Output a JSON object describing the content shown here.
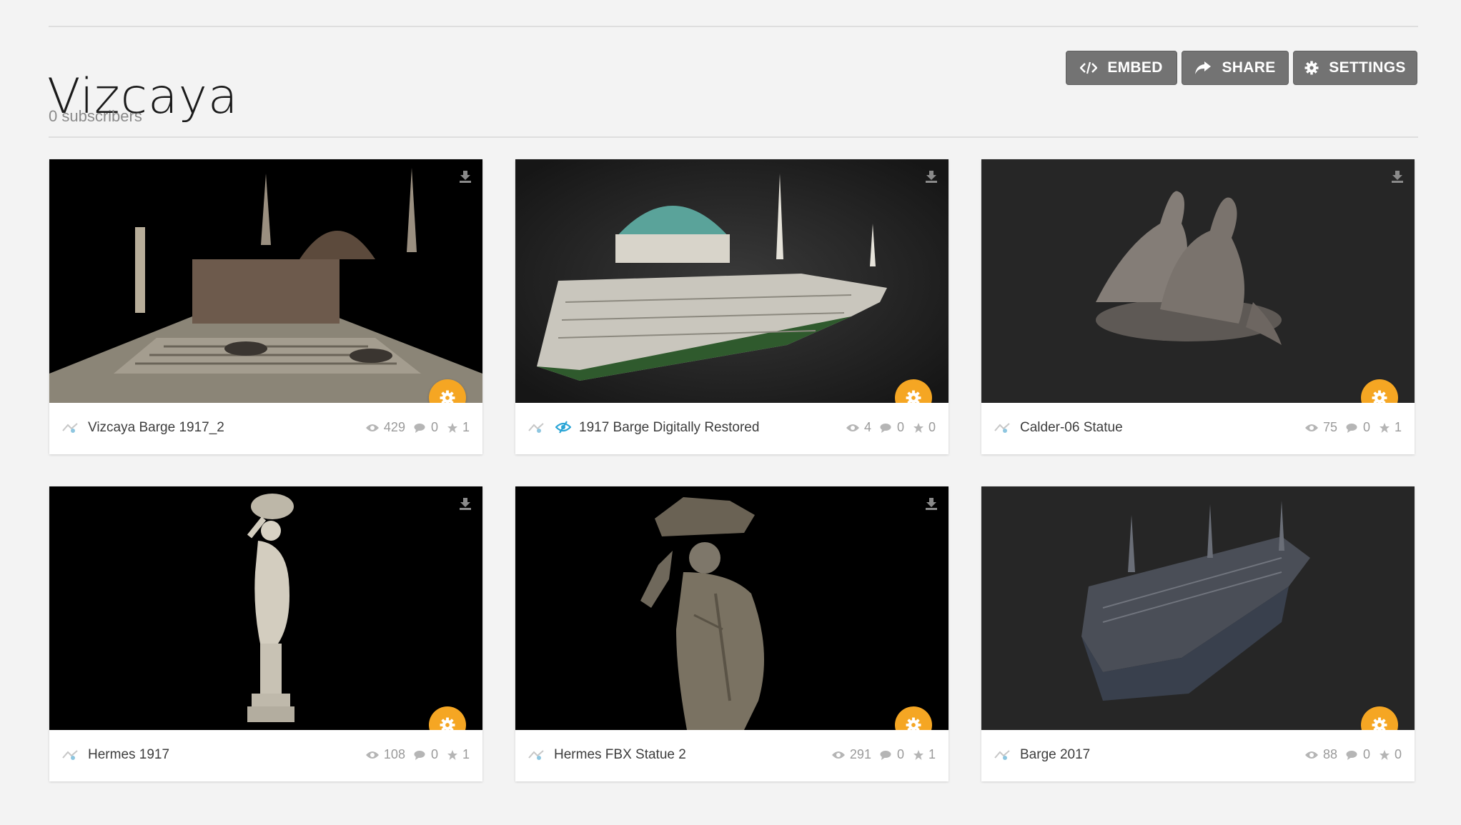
{
  "header": {
    "title": "Vizcaya",
    "subscribers": "0 subscribers"
  },
  "actions": {
    "embed": "EMBED",
    "share": "SHARE",
    "settings": "SETTINGS"
  },
  "colors": {
    "accent": "#f5a623",
    "button_bg": "#737373",
    "staff_pick": "#2aa5d6"
  },
  "models": [
    {
      "name": "Vizcaya Barge 1917_2",
      "views": "429",
      "comments": "0",
      "likes": "1",
      "staff_pick": false,
      "downloadable": true
    },
    {
      "name": "1917 Barge Digitally Restored",
      "views": "4",
      "comments": "0",
      "likes": "0",
      "staff_pick": true,
      "downloadable": true
    },
    {
      "name": "Calder-06 Statue",
      "views": "75",
      "comments": "0",
      "likes": "1",
      "staff_pick": false,
      "downloadable": true
    },
    {
      "name": "Hermes 1917",
      "views": "108",
      "comments": "0",
      "likes": "1",
      "staff_pick": false,
      "downloadable": true
    },
    {
      "name": "Hermes FBX Statue 2",
      "views": "291",
      "comments": "0",
      "likes": "1",
      "staff_pick": false,
      "downloadable": true
    },
    {
      "name": "Barge 2017",
      "views": "88",
      "comments": "0",
      "likes": "0",
      "staff_pick": false,
      "downloadable": false
    }
  ]
}
